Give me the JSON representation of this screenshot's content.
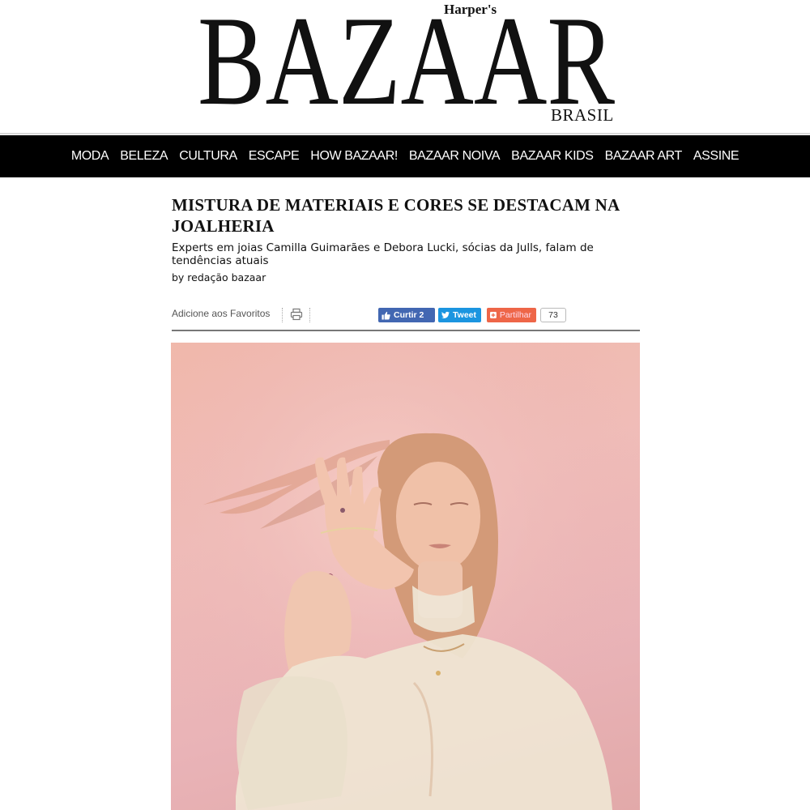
{
  "masthead": {
    "logo_top": "Harper's",
    "logo_main": "BAZAAR",
    "logo_edition": "BRASIL"
  },
  "nav": {
    "items": [
      "MODA",
      "BELEZA",
      "CULTURA",
      "ESCAPE",
      "HOW BAZAAR!",
      "BAZAAR NOIVA",
      "BAZAAR KIDS",
      "BAZAAR ART",
      "ASSINE"
    ]
  },
  "article": {
    "headline": "MISTURA DE MATERIAIS E CORES SE DESTACAM NA JOALHERIA",
    "subheadline": "Experts em joias Camilla Guimarães e Debora Lucki, sócias da Julls, falam de tendências atuais",
    "byline": "by redação bazaar"
  },
  "toolbar": {
    "favorites_label": "Adicione aos Favoritos",
    "print_icon": "print-icon",
    "like_label": "Curtir 2",
    "tweet_label": "Tweet",
    "share_label": "Partilhar",
    "share_count": "73"
  },
  "colors": {
    "nav_bg": "#000000",
    "like_bg": "#4267b2",
    "tweet_bg": "#1b95e0",
    "share_bg": "#ee6648",
    "photo_bg": "#f0bdb8"
  }
}
